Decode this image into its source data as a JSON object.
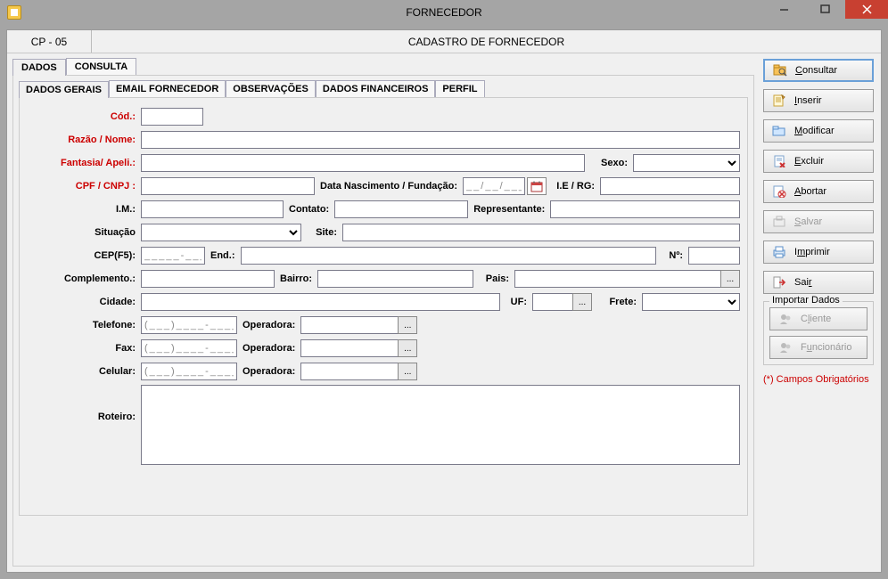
{
  "window": {
    "title": "FORNECEDOR"
  },
  "header": {
    "code": "CP - 05",
    "title": "CADASTRO DE FORNECEDOR"
  },
  "top_tabs": {
    "dados": "DADOS",
    "consulta": "CONSULTA"
  },
  "sub_tabs": {
    "gerais": "DADOS GERAIS",
    "email": "EMAIL FORNECEDOR",
    "obs": "OBSERVAÇÕES",
    "fin": "DADOS FINANCEIROS",
    "perfil": "PERFIL"
  },
  "labels": {
    "cod": "Cód.:",
    "razao": "Razão / Nome:",
    "fantasia": "Fantasia/ Apeli.:",
    "sexo": "Sexo:",
    "cpf": "CPF / CNPJ :",
    "nasc": "Data Nascimento / Fundação:",
    "ierg": "I.E / RG:",
    "im": "I.M.:",
    "contato": "Contato:",
    "repr": "Representante:",
    "sit": "Situação",
    "site": "Site:",
    "cep": "CEP(F5):",
    "end": "End.:",
    "num": "Nº:",
    "compl": "Complemento.:",
    "bairro": "Bairro:",
    "pais": "Pais:",
    "cidade": "Cidade:",
    "uf": "UF:",
    "frete": "Frete:",
    "tel": "Telefone:",
    "fax": "Fax:",
    "cel": "Celular:",
    "oper": "Operadora:",
    "roteiro": "Roteiro:"
  },
  "masks": {
    "date": "__/__/____",
    "cep": "_____-___",
    "phone": "(___)____-____"
  },
  "values": {
    "cod": "",
    "razao": "",
    "fantasia": "",
    "sexo": "",
    "cpf": "",
    "nasc": "",
    "ierg": "",
    "im": "",
    "contato": "",
    "repr": "",
    "sit": "",
    "site": "",
    "cep": "",
    "end": "",
    "num": "",
    "compl": "",
    "bairro": "",
    "pais": "",
    "cidade": "",
    "uf": "",
    "frete": "",
    "tel": "",
    "tel_oper": "",
    "fax": "",
    "fax_oper": "",
    "cel": "",
    "cel_oper": "",
    "roteiro": ""
  },
  "sidebar": {
    "consultar": "Consultar",
    "inserir": "Inserir",
    "modificar": "Modificar",
    "excluir": "Excluir",
    "abortar": "Abortar",
    "salvar": "Salvar",
    "imprimir": "Imprimir",
    "sair": "Sair",
    "importar_title": "Importar Dados",
    "cliente": "Cliente",
    "funcionario": "Funcionário",
    "footnote": "(*) Campos Obrigatórios"
  }
}
